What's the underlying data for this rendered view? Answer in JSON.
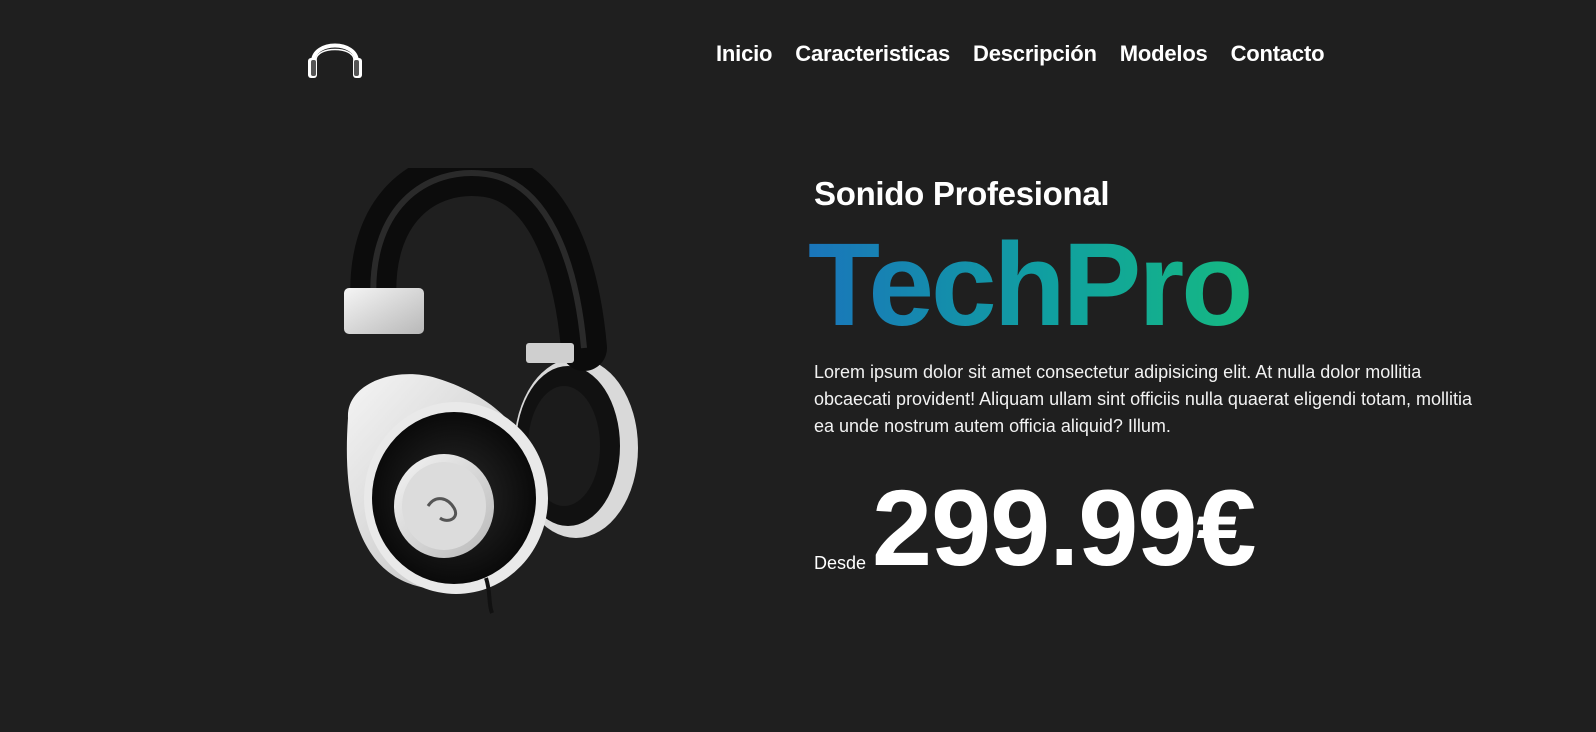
{
  "header": {
    "logo_icon": "headphones-icon",
    "nav": [
      {
        "label": "Inicio"
      },
      {
        "label": "Caracteristicas"
      },
      {
        "label": "Descripción"
      },
      {
        "label": "Modelos"
      },
      {
        "label": "Contacto"
      }
    ]
  },
  "hero": {
    "image": "headphones-product-image",
    "subtitle": "Sonido Profesional",
    "brand": "TechPro",
    "description": "Lorem ipsum dolor sit amet consectetur adipisicing elit. At nulla dolor mollitia obcaecati provident! Aliquam ullam sint officiis nulla quaerat eligendi totam, mollitia ea unde nostrum autem officia aliquid? Illum.",
    "price_prefix": "Desde",
    "price": "299.99€"
  },
  "colors": {
    "background": "#1f1f1f",
    "text": "#ffffff",
    "brand_gradient_start": "#1a75bb",
    "brand_gradient_end": "#16b981"
  }
}
